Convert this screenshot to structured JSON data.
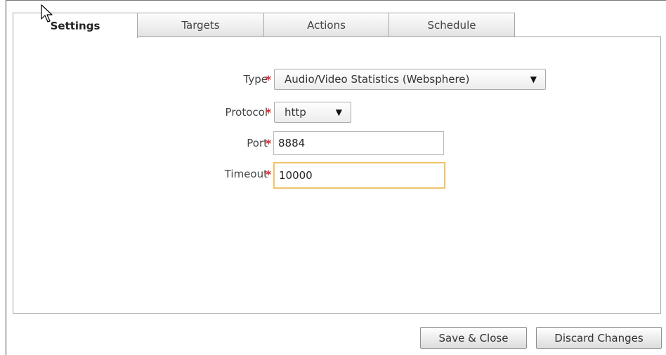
{
  "tabs": [
    {
      "label": "Settings",
      "active": true
    },
    {
      "label": "Targets",
      "active": false
    },
    {
      "label": "Actions",
      "active": false
    },
    {
      "label": "Schedule",
      "active": false
    }
  ],
  "form": {
    "required_marker": "*",
    "type": {
      "label": "Type",
      "value": "Audio/Video Statistics (Websphere)"
    },
    "protocol": {
      "label": "Protocol",
      "value": "http"
    },
    "port": {
      "label": "Port",
      "value": "8884"
    },
    "timeout": {
      "label": "Timeout",
      "value": "10000"
    }
  },
  "buttons": {
    "save_close": "Save & Close",
    "discard": "Discard Changes"
  },
  "colors": {
    "required": "#e1262b",
    "focus_border": "#f0c46e"
  },
  "icons": {
    "cursor": "mouse-pointer-icon",
    "dropdown": "dropdown-arrow-icon"
  }
}
